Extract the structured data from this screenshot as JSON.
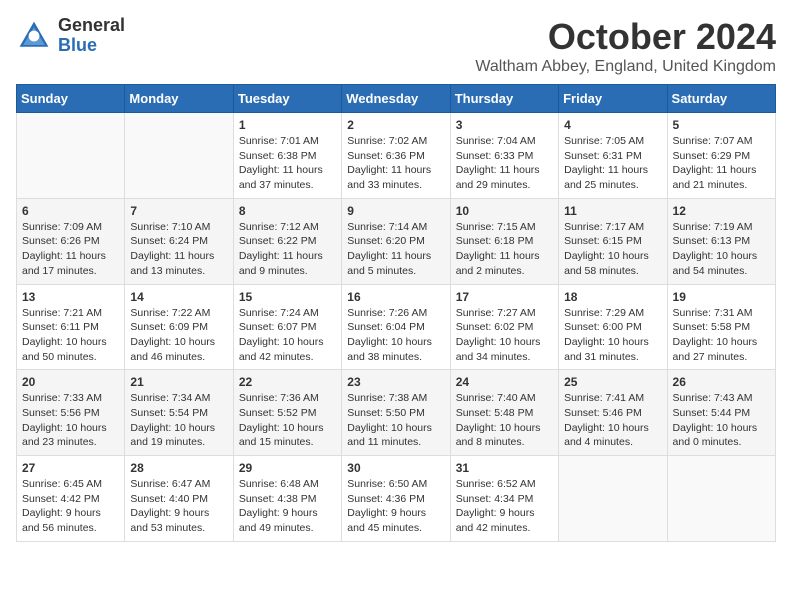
{
  "logo": {
    "general": "General",
    "blue": "Blue"
  },
  "title": "October 2024",
  "location": "Waltham Abbey, England, United Kingdom",
  "days_of_week": [
    "Sunday",
    "Monday",
    "Tuesday",
    "Wednesday",
    "Thursday",
    "Friday",
    "Saturday"
  ],
  "weeks": [
    [
      {
        "day": "",
        "info": ""
      },
      {
        "day": "",
        "info": ""
      },
      {
        "day": "1",
        "info": "Sunrise: 7:01 AM\nSunset: 6:38 PM\nDaylight: 11 hours and 37 minutes."
      },
      {
        "day": "2",
        "info": "Sunrise: 7:02 AM\nSunset: 6:36 PM\nDaylight: 11 hours and 33 minutes."
      },
      {
        "day": "3",
        "info": "Sunrise: 7:04 AM\nSunset: 6:33 PM\nDaylight: 11 hours and 29 minutes."
      },
      {
        "day": "4",
        "info": "Sunrise: 7:05 AM\nSunset: 6:31 PM\nDaylight: 11 hours and 25 minutes."
      },
      {
        "day": "5",
        "info": "Sunrise: 7:07 AM\nSunset: 6:29 PM\nDaylight: 11 hours and 21 minutes."
      }
    ],
    [
      {
        "day": "6",
        "info": "Sunrise: 7:09 AM\nSunset: 6:26 PM\nDaylight: 11 hours and 17 minutes."
      },
      {
        "day": "7",
        "info": "Sunrise: 7:10 AM\nSunset: 6:24 PM\nDaylight: 11 hours and 13 minutes."
      },
      {
        "day": "8",
        "info": "Sunrise: 7:12 AM\nSunset: 6:22 PM\nDaylight: 11 hours and 9 minutes."
      },
      {
        "day": "9",
        "info": "Sunrise: 7:14 AM\nSunset: 6:20 PM\nDaylight: 11 hours and 5 minutes."
      },
      {
        "day": "10",
        "info": "Sunrise: 7:15 AM\nSunset: 6:18 PM\nDaylight: 11 hours and 2 minutes."
      },
      {
        "day": "11",
        "info": "Sunrise: 7:17 AM\nSunset: 6:15 PM\nDaylight: 10 hours and 58 minutes."
      },
      {
        "day": "12",
        "info": "Sunrise: 7:19 AM\nSunset: 6:13 PM\nDaylight: 10 hours and 54 minutes."
      }
    ],
    [
      {
        "day": "13",
        "info": "Sunrise: 7:21 AM\nSunset: 6:11 PM\nDaylight: 10 hours and 50 minutes."
      },
      {
        "day": "14",
        "info": "Sunrise: 7:22 AM\nSunset: 6:09 PM\nDaylight: 10 hours and 46 minutes."
      },
      {
        "day": "15",
        "info": "Sunrise: 7:24 AM\nSunset: 6:07 PM\nDaylight: 10 hours and 42 minutes."
      },
      {
        "day": "16",
        "info": "Sunrise: 7:26 AM\nSunset: 6:04 PM\nDaylight: 10 hours and 38 minutes."
      },
      {
        "day": "17",
        "info": "Sunrise: 7:27 AM\nSunset: 6:02 PM\nDaylight: 10 hours and 34 minutes."
      },
      {
        "day": "18",
        "info": "Sunrise: 7:29 AM\nSunset: 6:00 PM\nDaylight: 10 hours and 31 minutes."
      },
      {
        "day": "19",
        "info": "Sunrise: 7:31 AM\nSunset: 5:58 PM\nDaylight: 10 hours and 27 minutes."
      }
    ],
    [
      {
        "day": "20",
        "info": "Sunrise: 7:33 AM\nSunset: 5:56 PM\nDaylight: 10 hours and 23 minutes."
      },
      {
        "day": "21",
        "info": "Sunrise: 7:34 AM\nSunset: 5:54 PM\nDaylight: 10 hours and 19 minutes."
      },
      {
        "day": "22",
        "info": "Sunrise: 7:36 AM\nSunset: 5:52 PM\nDaylight: 10 hours and 15 minutes."
      },
      {
        "day": "23",
        "info": "Sunrise: 7:38 AM\nSunset: 5:50 PM\nDaylight: 10 hours and 11 minutes."
      },
      {
        "day": "24",
        "info": "Sunrise: 7:40 AM\nSunset: 5:48 PM\nDaylight: 10 hours and 8 minutes."
      },
      {
        "day": "25",
        "info": "Sunrise: 7:41 AM\nSunset: 5:46 PM\nDaylight: 10 hours and 4 minutes."
      },
      {
        "day": "26",
        "info": "Sunrise: 7:43 AM\nSunset: 5:44 PM\nDaylight: 10 hours and 0 minutes."
      }
    ],
    [
      {
        "day": "27",
        "info": "Sunrise: 6:45 AM\nSunset: 4:42 PM\nDaylight: 9 hours and 56 minutes."
      },
      {
        "day": "28",
        "info": "Sunrise: 6:47 AM\nSunset: 4:40 PM\nDaylight: 9 hours and 53 minutes."
      },
      {
        "day": "29",
        "info": "Sunrise: 6:48 AM\nSunset: 4:38 PM\nDaylight: 9 hours and 49 minutes."
      },
      {
        "day": "30",
        "info": "Sunrise: 6:50 AM\nSunset: 4:36 PM\nDaylight: 9 hours and 45 minutes."
      },
      {
        "day": "31",
        "info": "Sunrise: 6:52 AM\nSunset: 4:34 PM\nDaylight: 9 hours and 42 minutes."
      },
      {
        "day": "",
        "info": ""
      },
      {
        "day": "",
        "info": ""
      }
    ]
  ]
}
